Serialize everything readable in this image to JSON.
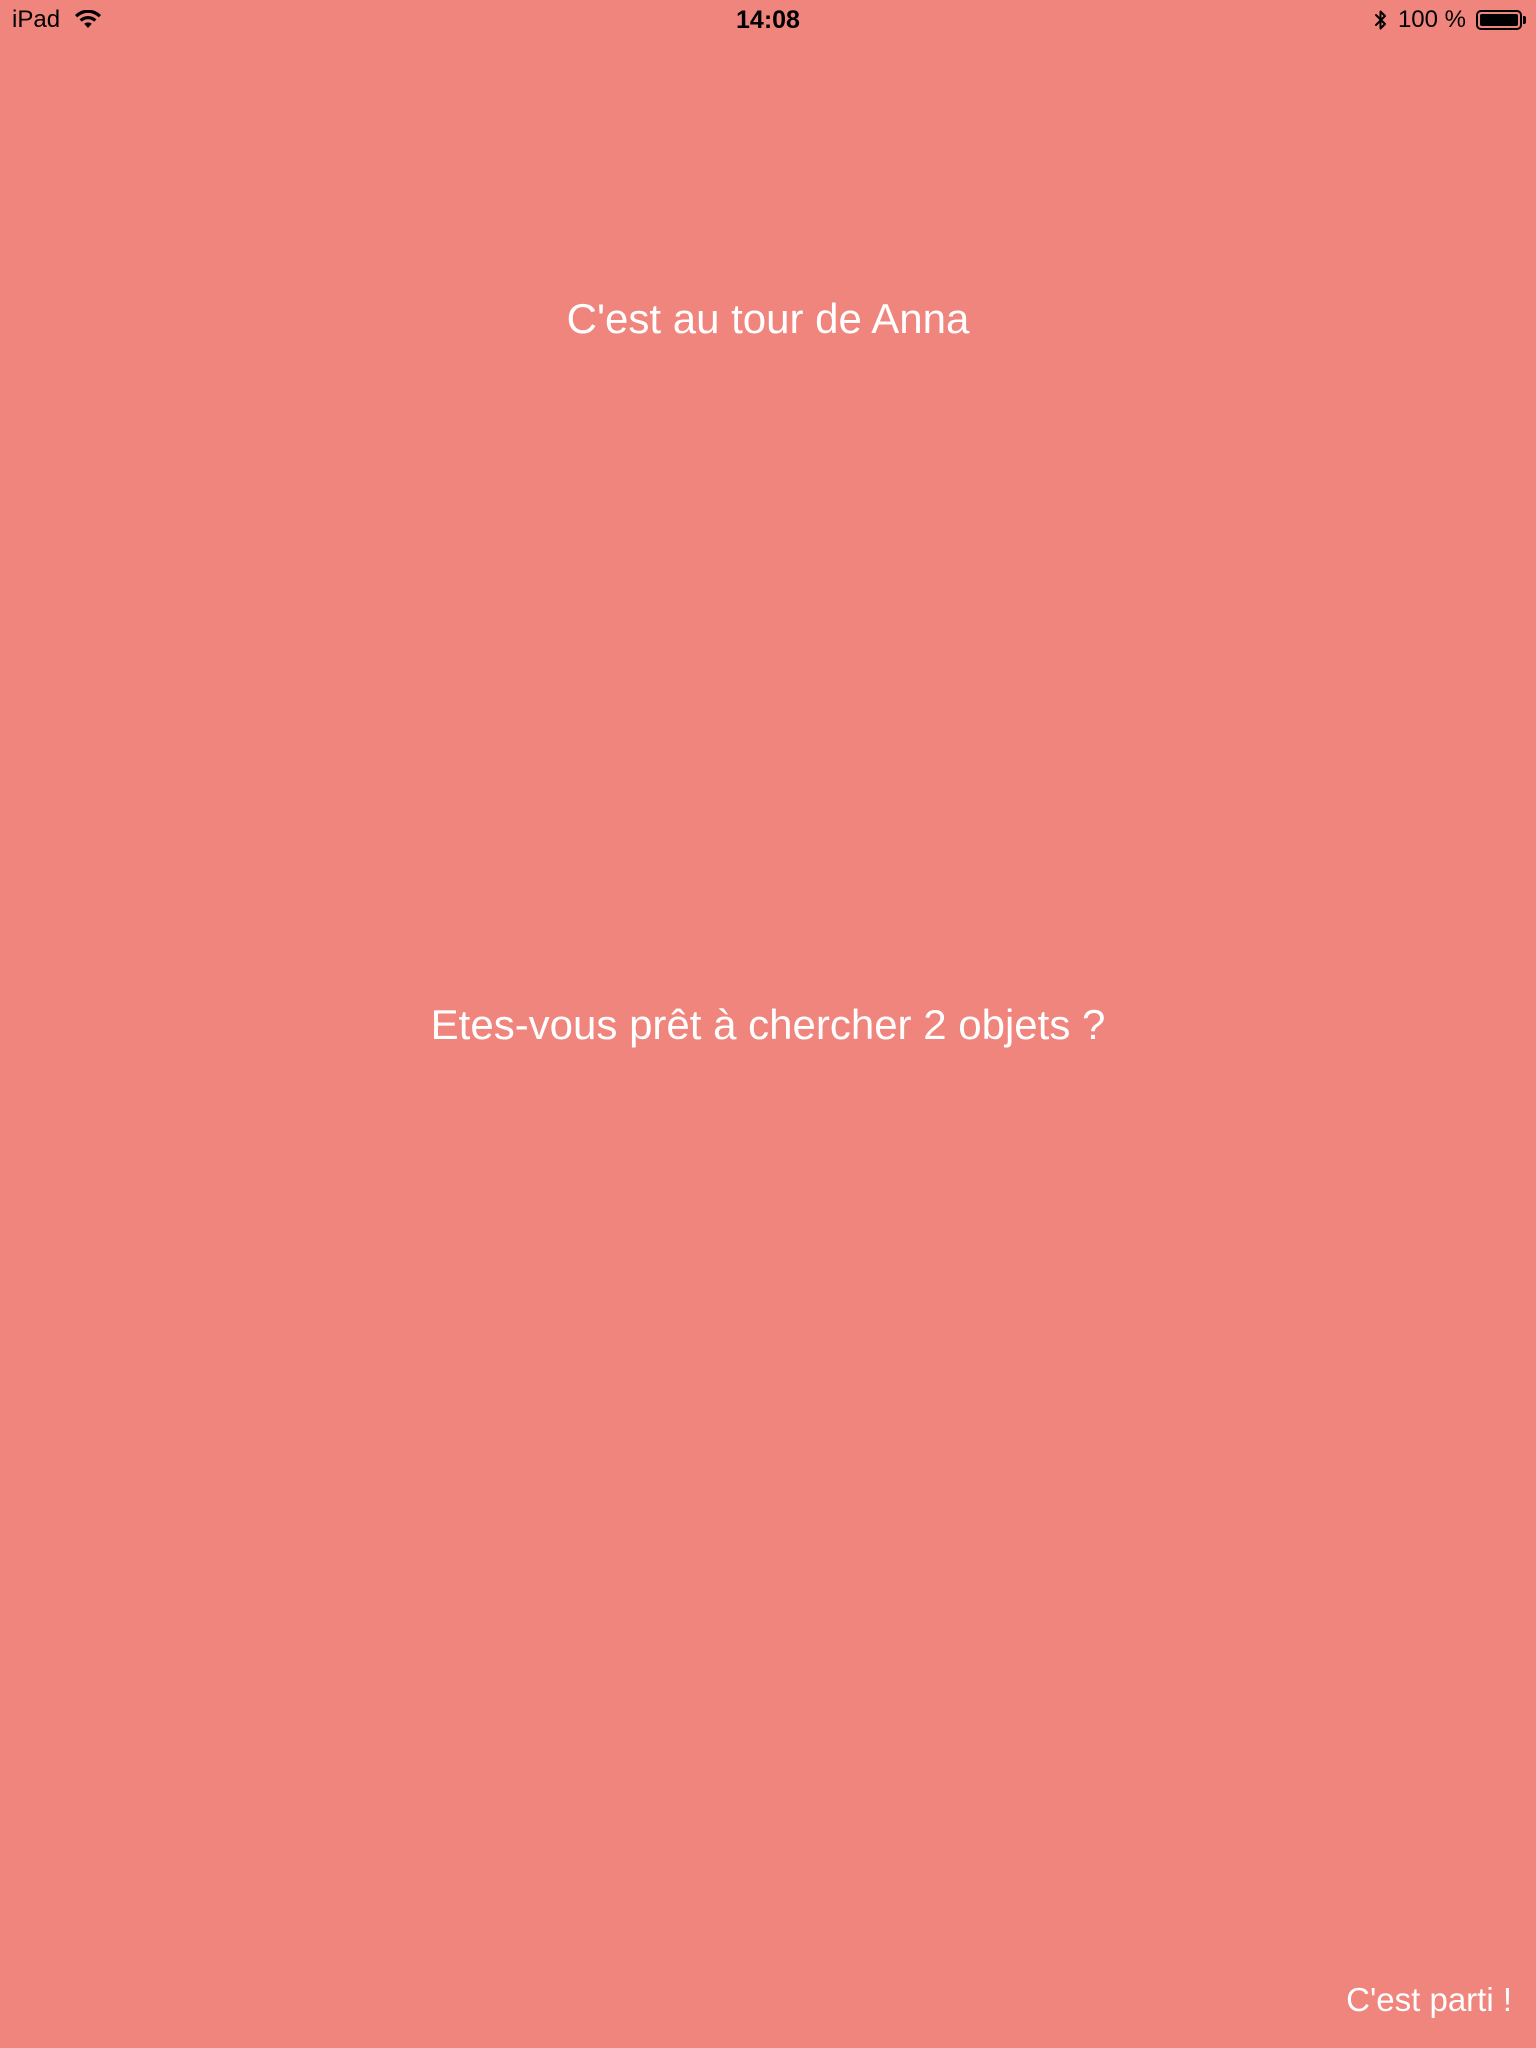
{
  "theme": {
    "background": "#ef857c",
    "text_color": "#ffffff",
    "status_text_color": "#000000"
  },
  "status_bar": {
    "device": "iPad",
    "time": "14:08",
    "battery_label": "100 %",
    "battery_level": 1.0,
    "icons": [
      "wifi-icon",
      "bluetooth-icon",
      "battery-icon"
    ]
  },
  "main": {
    "turn_title": "C'est au tour de Anna",
    "prompt": "Etes-vous prêt à chercher 2 objets ?",
    "go_button_label": "C'est parti !"
  }
}
